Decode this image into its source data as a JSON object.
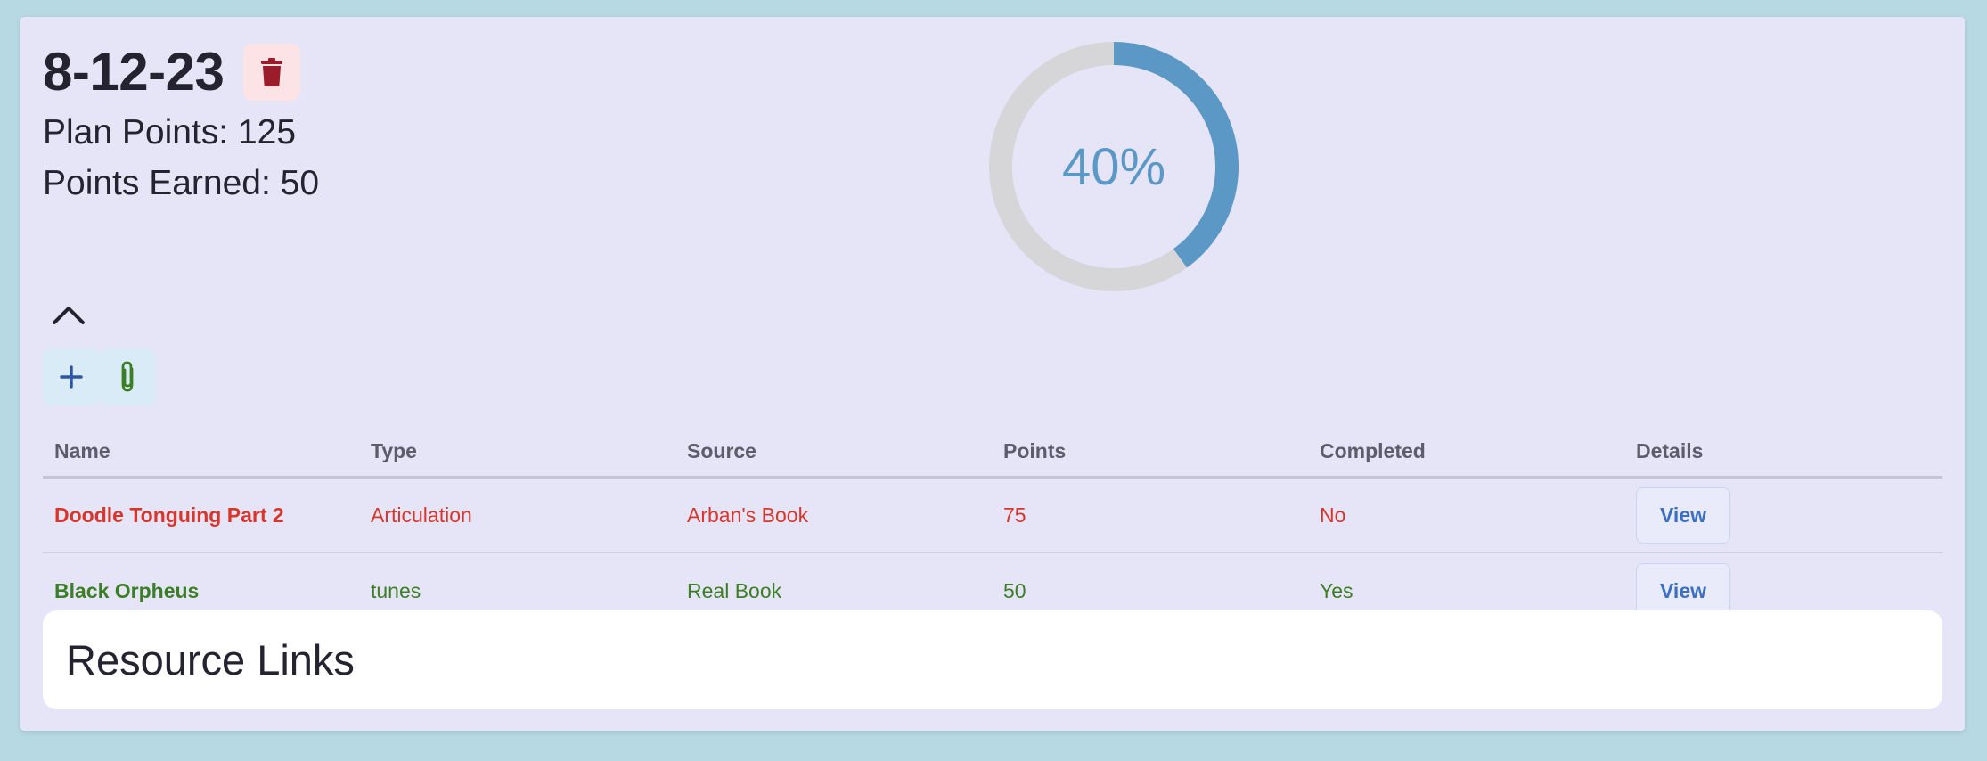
{
  "plan": {
    "title": "8-12-23",
    "plan_points_text": "Plan Points: 125",
    "points_earned_text": "Points Earned: 50"
  },
  "progress": {
    "percent_label": "40%",
    "fraction": 0.4,
    "fill_color": "#5b98c6",
    "track_color": "#d6d6d8"
  },
  "icons": {
    "delete": "trash-icon",
    "collapse": "chevron-up-icon",
    "add": "plus-icon",
    "attach": "paperclip-icon"
  },
  "table": {
    "headers": [
      "Name",
      "Type",
      "Source",
      "Points",
      "Completed",
      "Details"
    ],
    "rows": [
      {
        "name": "Doodle Tonguing Part 2",
        "type": "Articulation",
        "source": "Arban's Book",
        "points": "75",
        "completed": "No",
        "action": "View",
        "status_color": "#d9362b"
      },
      {
        "name": "Black Orpheus",
        "type": "tunes",
        "source": "Real Book",
        "points": "50",
        "completed": "Yes",
        "action": "View",
        "status_color": "#3c7e26"
      }
    ]
  },
  "resources": {
    "title": "Resource Links"
  }
}
